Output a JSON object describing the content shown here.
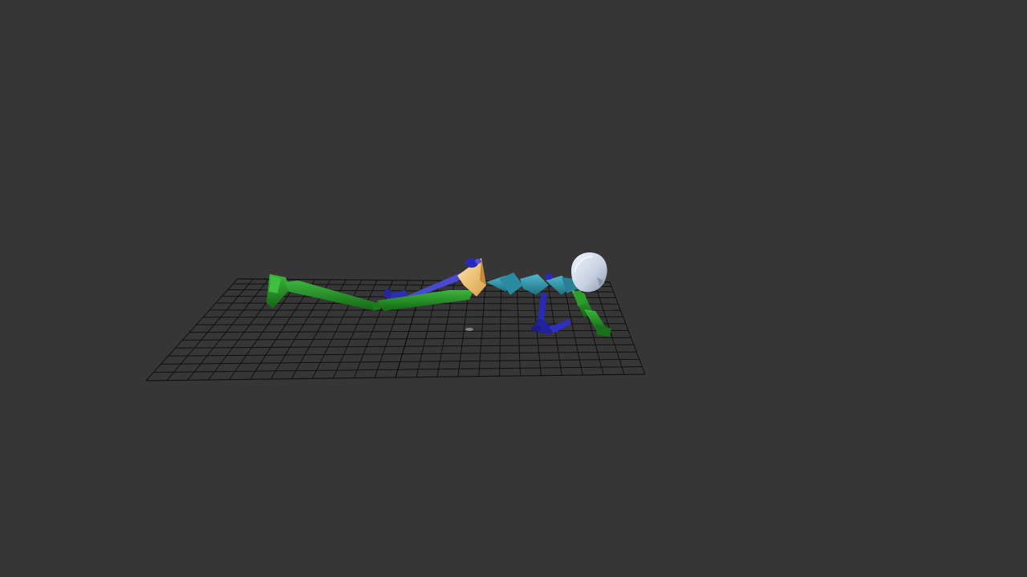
{
  "viewport": {
    "background_color": "#363636",
    "view": "perspective",
    "grid": {
      "visible": true,
      "line_color": "#101010",
      "origin_marker_color": "#9a9a9a"
    },
    "figure": {
      "pose": "prone push-up",
      "colors": {
        "legs_right": "#1f8a1f",
        "legs_left": "#3a3ab8",
        "pelvis": "#f2c36b",
        "spine": "#2e8fa6",
        "arm_right": "#1f8a1f",
        "arm_left": "#2a2aa8",
        "head": "#cfd8e6"
      }
    }
  }
}
